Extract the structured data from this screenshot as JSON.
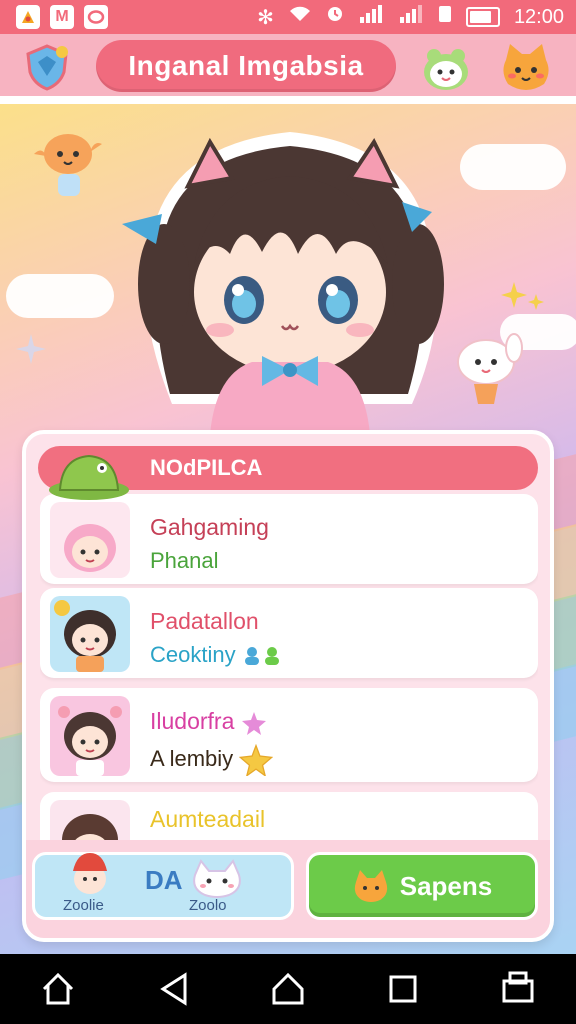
{
  "status_bar": {
    "time": "12:00",
    "apps": [
      "M"
    ]
  },
  "header": {
    "title": "Inganal Imgabsia"
  },
  "panel": {
    "title": "NOdPILCA",
    "rows": [
      {
        "title": "Gahgaming",
        "subtitle": "Phanal",
        "title_color": "#c54057",
        "subtitle_color": "#4aa43b"
      },
      {
        "title": "Padatallon",
        "subtitle": "Ceoktiny",
        "title_color": "#e0506a",
        "subtitle_color": "#2aa3c7"
      },
      {
        "title": "Iludorfra",
        "subtitle": "A lembiy",
        "title_color": "#d83fa2",
        "subtitle_color": "#3a2a1a"
      },
      {
        "title": "Aumteadail",
        "subtitle": "",
        "title_color": "#e9c32a",
        "subtitle_color": "#333333"
      }
    ]
  },
  "bottom_buttons": {
    "left_label": "DA",
    "left_sub_1": "Zoolie",
    "left_sub_2": "Zoolo",
    "right_label": "Sapens"
  },
  "colors": {
    "accent": "#f26a7b",
    "panel_bg": "#fde2ea",
    "green": "#6ccb49"
  },
  "icons": [
    "shield-icon",
    "cat-face-icon",
    "home-icon",
    "back-icon",
    "recent-apps-icon",
    "screenshot-icon",
    "wifi-icon",
    "signal-icon",
    "battery-icon"
  ]
}
